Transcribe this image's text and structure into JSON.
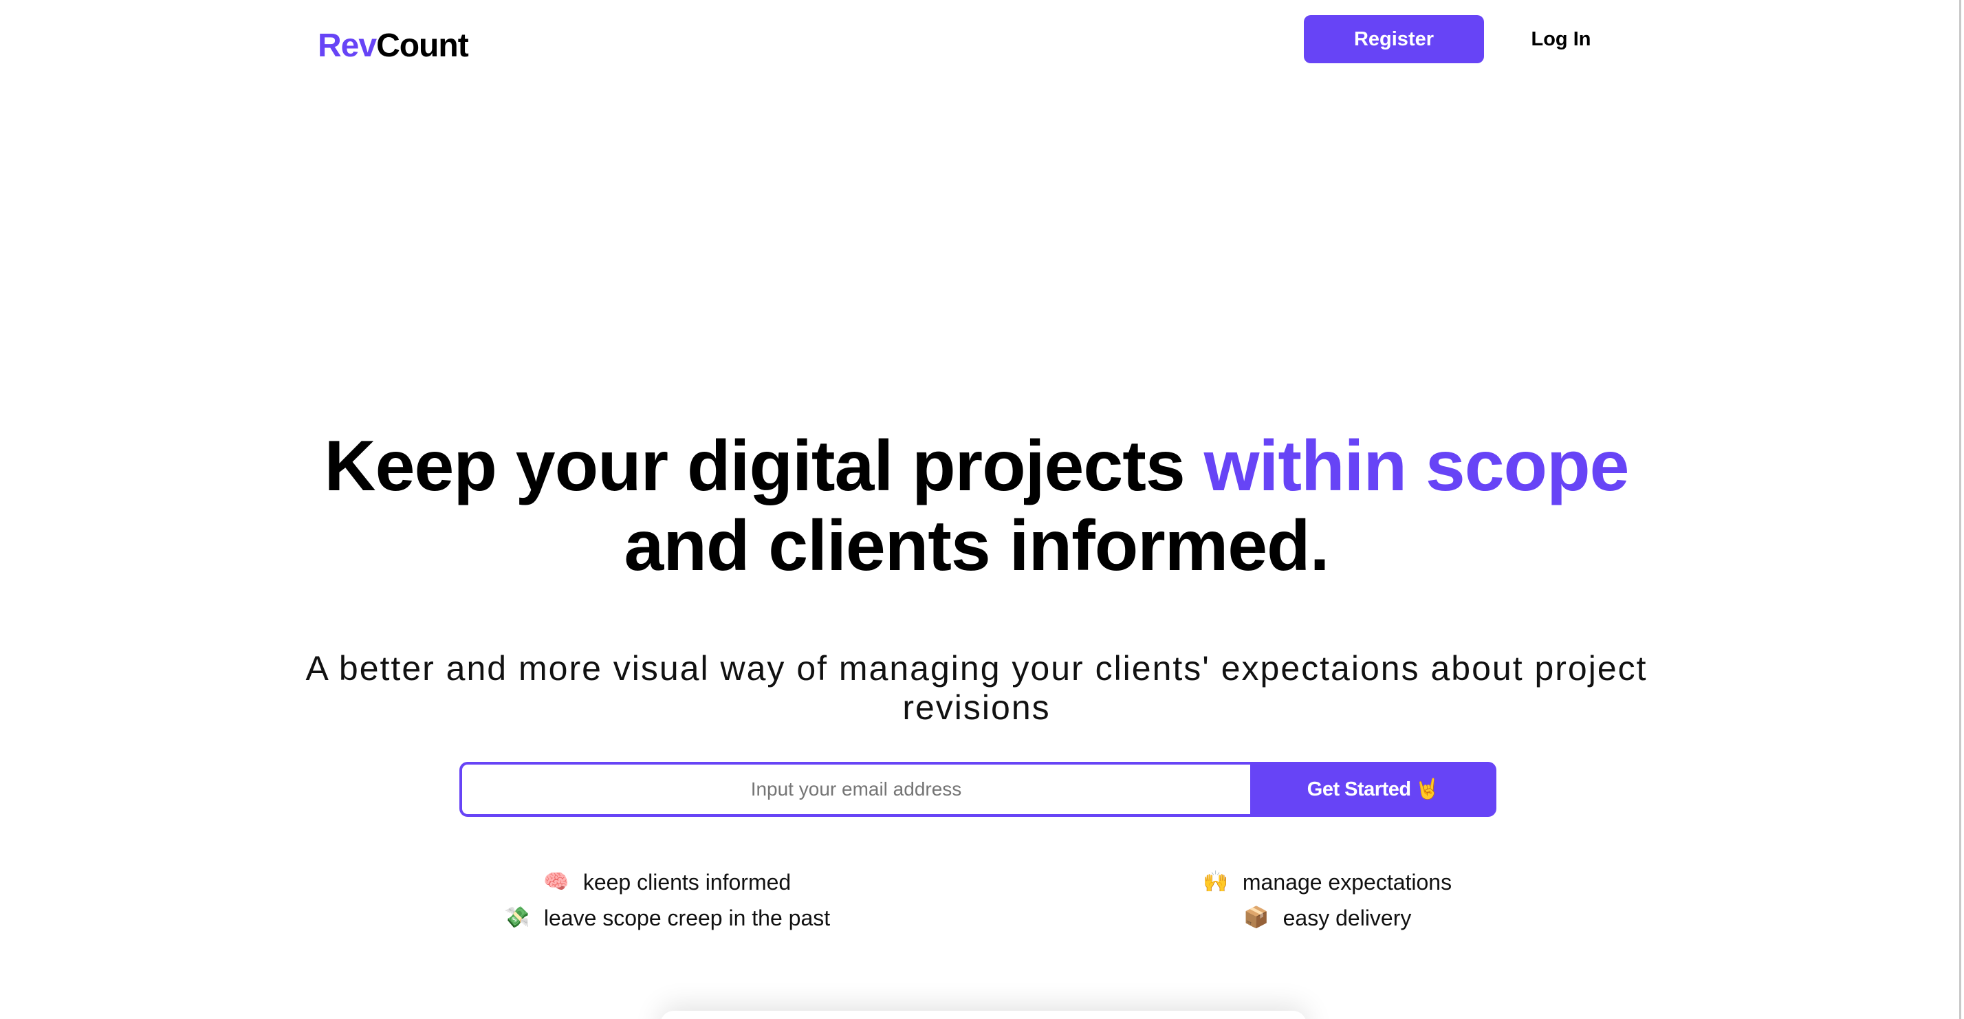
{
  "header": {
    "logo_accent": "Rev",
    "logo_main": "Count",
    "register_label": "Register",
    "login_label": "Log In"
  },
  "hero": {
    "title_before": "Keep your digital projects ",
    "title_accent": "within scope",
    "title_after": " and clients informed.",
    "subtitle": "A better and more visual way of managing your clients' expectaions about project revisions"
  },
  "signup": {
    "email_placeholder": "Input your email address",
    "email_value": "",
    "cta_label": "Get Started",
    "cta_emoji": "🤘"
  },
  "features": {
    "left": [
      {
        "icon": "brain-icon",
        "emoji": "🧠",
        "label": "keep clients informed"
      },
      {
        "icon": "flying-money-icon",
        "emoji": "💸",
        "label": "leave scope creep in the past"
      }
    ],
    "right": [
      {
        "icon": "raised-hands-icon",
        "emoji": "🙌",
        "label": "manage expectations"
      },
      {
        "icon": "package-icon",
        "emoji": "📦",
        "label": "easy delivery"
      }
    ]
  },
  "colors": {
    "accent": "#6744f6",
    "text": "#000000",
    "background": "#ffffff"
  }
}
